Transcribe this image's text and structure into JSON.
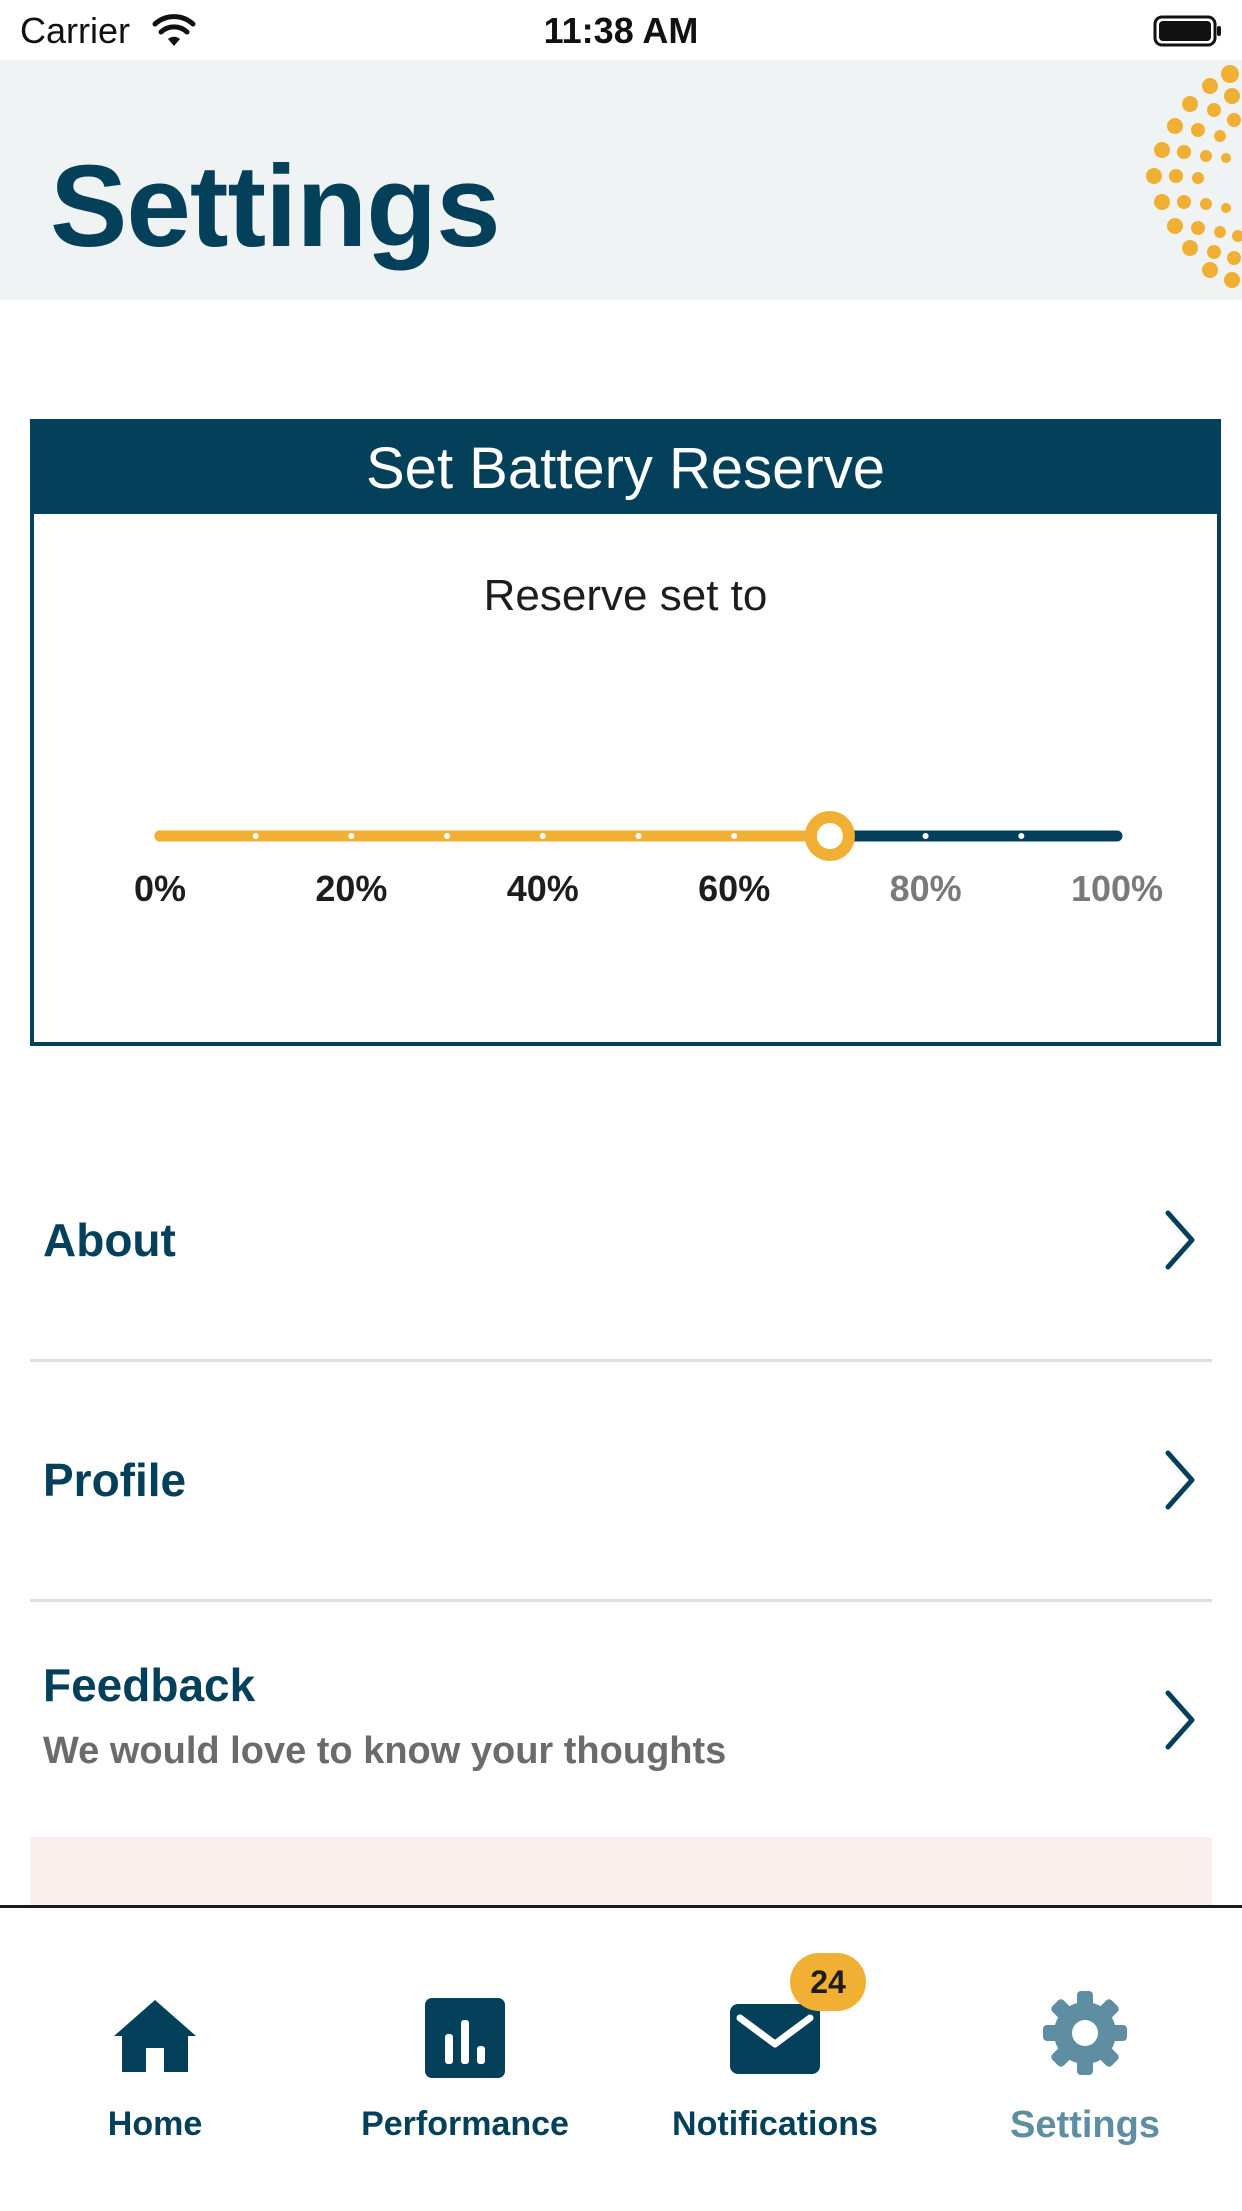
{
  "status_bar": {
    "carrier": "Carrier",
    "time": "11:38 AM"
  },
  "header": {
    "title": "Settings"
  },
  "reserve": {
    "heading": "Set Battery Reserve",
    "subtitle": "Reserve set to",
    "value_percent": 70,
    "tick_labels": [
      "0%",
      "20%",
      "40%",
      "60%",
      "80%",
      "100%"
    ],
    "colors": {
      "active": "#f1b034",
      "inactive": "#05405a"
    }
  },
  "menu": [
    {
      "title": "About",
      "subtitle": ""
    },
    {
      "title": "Profile",
      "subtitle": ""
    },
    {
      "title": "Feedback",
      "subtitle": "We would love to know your thoughts"
    }
  ],
  "tab_bar": {
    "items": [
      {
        "label": "Home",
        "icon": "home-icon"
      },
      {
        "label": "Performance",
        "icon": "bar-chart-icon"
      },
      {
        "label": "Notifications",
        "icon": "mail-icon"
      },
      {
        "label": "Settings",
        "icon": "gear-icon"
      }
    ],
    "notification_count": "24",
    "active_tab": "Settings"
  },
  "colors": {
    "brand_dark": "#05405a",
    "brand_accent": "#f1b034",
    "header_bg": "#eff3f4",
    "inactive_tab": "#5f8ea3"
  }
}
